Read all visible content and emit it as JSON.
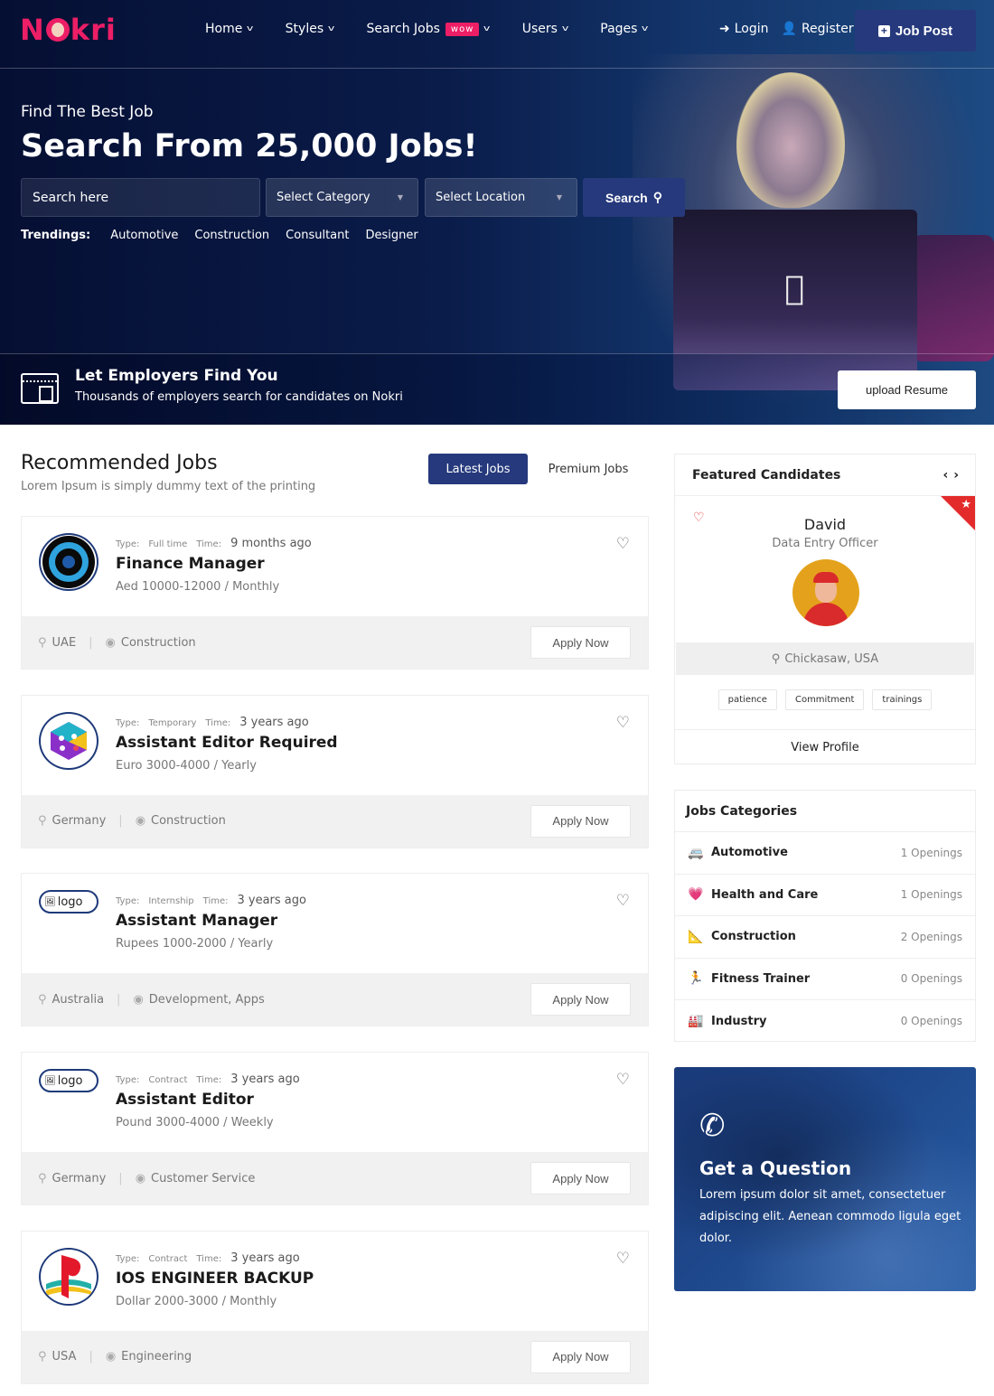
{
  "brand": {
    "name": "Nokri",
    "accent": "#ec1e66",
    "primary": "#25397c"
  },
  "nav": {
    "items": [
      {
        "label": "Home",
        "icon": "chevron-down-icon"
      },
      {
        "label": "Styles",
        "icon": "chevron-down-icon"
      },
      {
        "label": "Search Jobs",
        "badge": "wow",
        "icon": "chevron-down-icon"
      },
      {
        "label": "Users",
        "icon": "chevron-down-icon"
      },
      {
        "label": "Pages",
        "icon": "chevron-down-icon"
      }
    ],
    "login": "Login",
    "register": "Register",
    "job_post": "Job Post"
  },
  "hero": {
    "subtitle": "Find The Best Job",
    "title": "Search From 25,000 Jobs!",
    "search_placeholder": "Search here",
    "category_select": "Select Category",
    "location_select": "Select Location",
    "search_button": "Search",
    "trending_label": "Trendings:",
    "trending": [
      "Automotive",
      "Construction",
      "Consultant",
      "Designer"
    ]
  },
  "employers": {
    "title": "Let Employers Find You",
    "description": "Thousands of employers search for candidates on Nokri",
    "button": "upload Resume"
  },
  "recommended": {
    "title": "Recommended Jobs",
    "subtitle": "Lorem Ipsum is simply dummy text of the printing",
    "tabs": [
      {
        "label": "Latest Jobs",
        "active": true
      },
      {
        "label": "Premium Jobs",
        "active": false
      }
    ],
    "type_label": "Type:",
    "time_label": "Time:",
    "apply_label": "Apply Now",
    "jobs": [
      {
        "type": "Full time",
        "time": "9 months ago",
        "title": "Finance Manager",
        "salary": "Aed 10000-12000 / Monthly",
        "location": "UAE",
        "category": "Construction",
        "logo": "target-logo"
      },
      {
        "type": "Temporary",
        "time": "3 years ago",
        "title": "Assistant Editor Required",
        "salary": "Euro 3000-4000 / Yearly",
        "location": "Germany",
        "category": "Construction",
        "logo": "hexagon-logo"
      },
      {
        "type": "Internship",
        "time": "3 years ago",
        "title": "Assistant Manager",
        "salary": "Rupees 1000-2000 / Yearly",
        "location": "Australia",
        "category": "Development, Apps",
        "logo": "broken",
        "logo_alt": "logo"
      },
      {
        "type": "Contract",
        "time": "3 years ago",
        "title": "Assistant Editor",
        "salary": "Pound 3000-4000 / Weekly",
        "location": "Germany",
        "category": "Customer Service",
        "logo": "broken",
        "logo_alt": "logo"
      },
      {
        "type": "Contract",
        "time": "3 years ago",
        "title": "IOS ENGINEER BACKUP",
        "salary": "Dollar 2000-3000 / Monthly",
        "location": "USA",
        "category": "Engineering",
        "logo": "playstation-logo"
      }
    ]
  },
  "featured": {
    "title": "Featured Candidates",
    "candidate": {
      "name": "David",
      "role": "Data Entry Officer",
      "location": "Chickasaw, USA",
      "skills": [
        "patience",
        "Commitment",
        "trainings"
      ]
    },
    "view_profile": "View Profile"
  },
  "categories": {
    "title": "Jobs Categories",
    "items": [
      {
        "name": "Automotive",
        "count": "1 Openings",
        "icon": "🚐"
      },
      {
        "name": "Health and Care",
        "count": "1 Openings",
        "icon": "💗"
      },
      {
        "name": "Construction",
        "count": "2 Openings",
        "icon": "📐"
      },
      {
        "name": "Fitness Trainer",
        "count": "0 Openings",
        "icon": "🏃"
      },
      {
        "name": "Industry",
        "count": "0 Openings",
        "icon": "🏭"
      }
    ]
  },
  "question": {
    "title": "Get a Question",
    "text": "Lorem ipsum dolor sit amet, consectetuer adipiscing elit. Aenean commodo ligula eget dolor."
  }
}
